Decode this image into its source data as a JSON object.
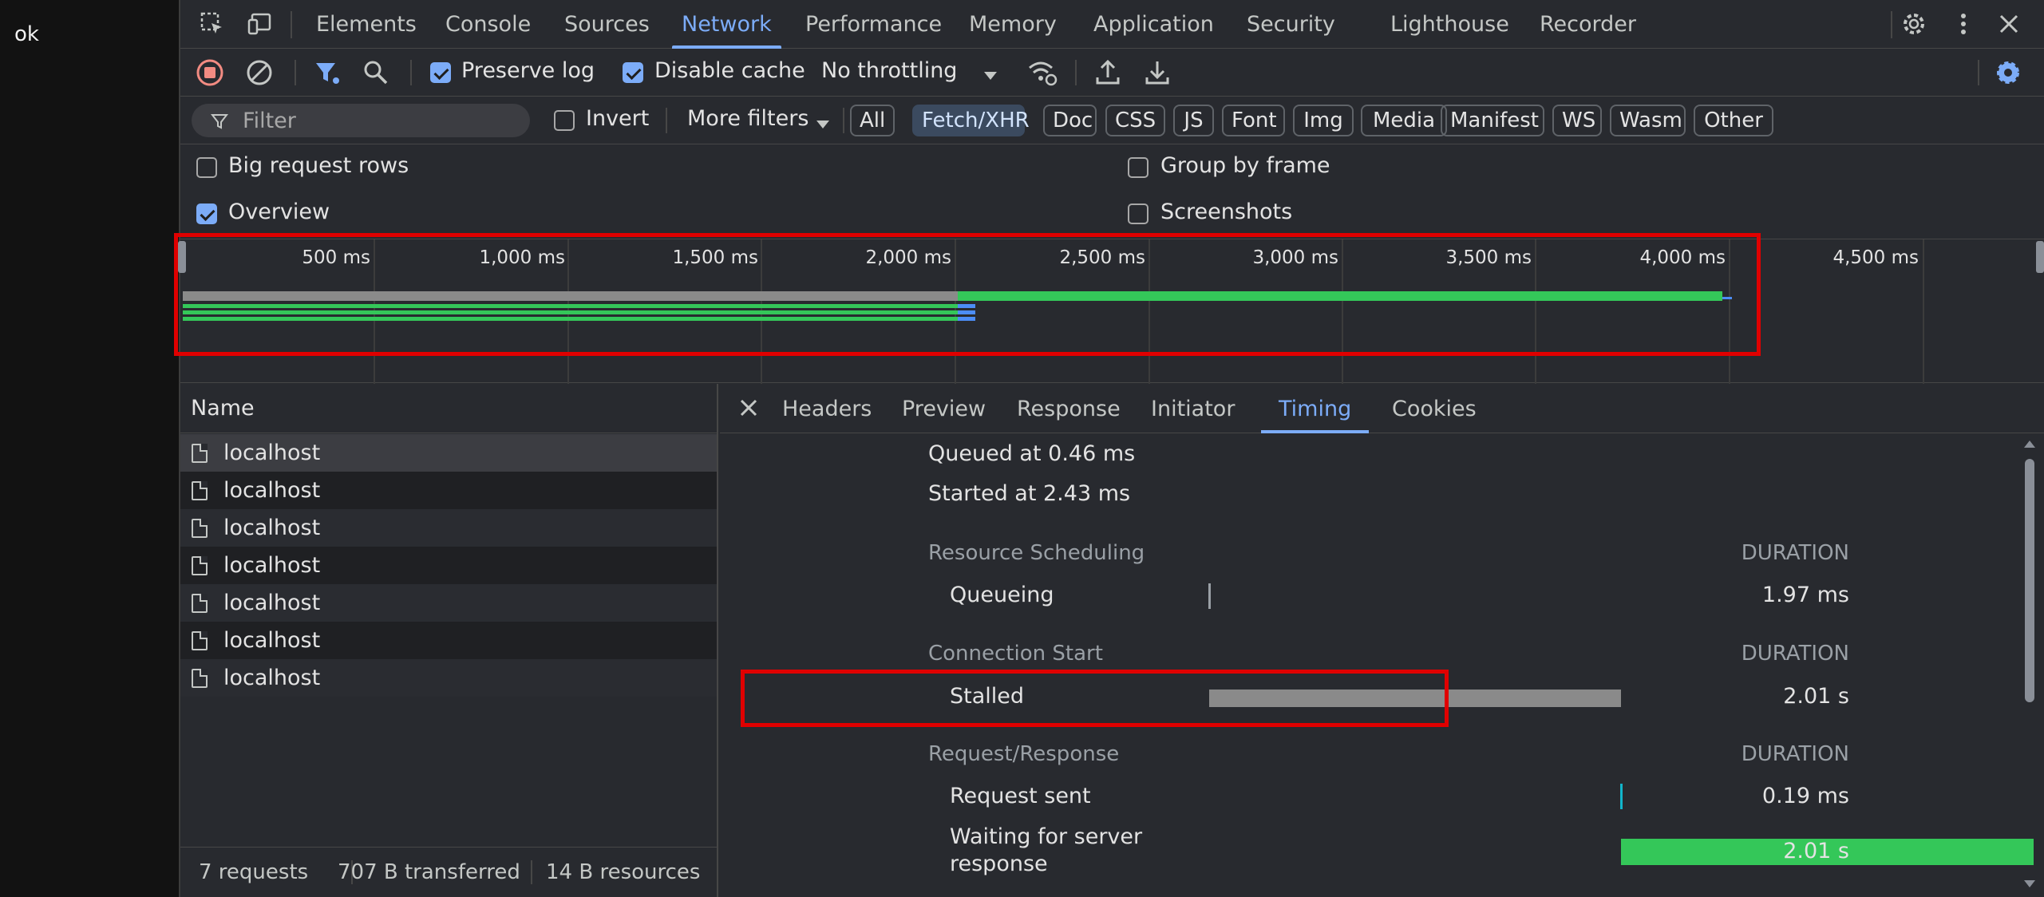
{
  "left_page": {
    "text": "ok"
  },
  "tabs": [
    {
      "label": "Elements"
    },
    {
      "label": "Console"
    },
    {
      "label": "Sources"
    },
    {
      "label": "Network",
      "active": true
    },
    {
      "label": "Performance"
    },
    {
      "label": "Memory"
    },
    {
      "label": "Application"
    },
    {
      "label": "Security"
    },
    {
      "label": "Lighthouse"
    },
    {
      "label": "Recorder"
    }
  ],
  "toolbar": {
    "preserve_log": "Preserve log",
    "preserve_log_checked": true,
    "disable_cache": "Disable cache",
    "disable_cache_checked": true,
    "throttling": "No throttling"
  },
  "filterbar": {
    "placeholder": "Filter",
    "invert": "Invert",
    "more_filters": "More filters",
    "types": [
      "All",
      "Fetch/XHR",
      "Doc",
      "CSS",
      "JS",
      "Font",
      "Img",
      "Media",
      "Manifest",
      "WS",
      "Wasm",
      "Other"
    ],
    "active_type": "Fetch/XHR"
  },
  "settings": {
    "big_request_rows": "Big request rows",
    "group_by_frame": "Group by frame",
    "overview": "Overview",
    "overview_checked": true,
    "screenshots": "Screenshots"
  },
  "overview": {
    "ticks": [
      "500 ms",
      "1,000 ms",
      "1,500 ms",
      "2,000 ms",
      "2,500 ms",
      "3,000 ms",
      "3,500 ms",
      "4,000 ms",
      "4,500 ms"
    ]
  },
  "requests": {
    "header": "Name",
    "rows": [
      "localhost",
      "localhost",
      "localhost",
      "localhost",
      "localhost",
      "localhost",
      "localhost"
    ]
  },
  "status": {
    "requests": "7 requests",
    "transferred": "707 B transferred",
    "resources": "14 B resources"
  },
  "detail_tabs": [
    {
      "label": "Headers"
    },
    {
      "label": "Preview"
    },
    {
      "label": "Response"
    },
    {
      "label": "Initiator"
    },
    {
      "label": "Timing",
      "active": true
    },
    {
      "label": "Cookies"
    }
  ],
  "timing": {
    "queued_at": "Queued at 0.46 ms",
    "started_at": "Started at 2.43 ms",
    "duration_label": "DURATION",
    "sections": [
      {
        "title": "Resource Scheduling",
        "rows": [
          {
            "label": "Queueing",
            "value": "1.97 ms"
          }
        ]
      },
      {
        "title": "Connection Start",
        "rows": [
          {
            "label": "Stalled",
            "value": "2.01 s"
          }
        ]
      },
      {
        "title": "Request/Response",
        "rows": [
          {
            "label": "Request sent",
            "value": "0.19 ms"
          },
          {
            "label": "Waiting for server",
            "label2": "response",
            "value": "2.01 s"
          }
        ]
      }
    ]
  },
  "colors": {
    "accent": "#7cacf8",
    "green": "#34c759",
    "stalled_grey": "#8a8a8a",
    "highlight_red": "#e00000"
  }
}
